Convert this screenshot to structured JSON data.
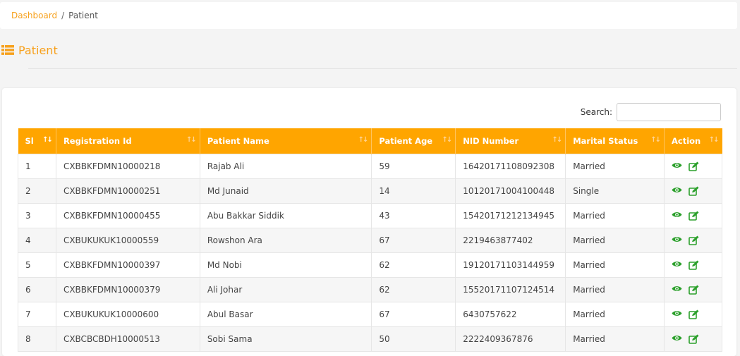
{
  "breadcrumb": {
    "home": "Dashboard",
    "separator": "/",
    "current": "Patient"
  },
  "page": {
    "title": "Patient"
  },
  "search": {
    "label": "Search:",
    "value": "",
    "placeholder": ""
  },
  "table": {
    "columns": [
      "Sl",
      "Registration Id",
      "Patient Name",
      "Patient Age",
      "NID Number",
      "Marital Status",
      "Action"
    ],
    "rows": [
      {
        "sl": "1",
        "reg": "CXBBKFDMN10000218",
        "name": "Rajab Ali",
        "age": "59",
        "nid": "16420171108092308",
        "marital": "Married"
      },
      {
        "sl": "2",
        "reg": "CXBBKFDMN10000251",
        "name": "Md Junaid",
        "age": "14",
        "nid": "10120171004100448",
        "marital": "Single"
      },
      {
        "sl": "3",
        "reg": "CXBBKFDMN10000455",
        "name": "Abu Bakkar Siddik",
        "age": "43",
        "nid": "15420171212134945",
        "marital": "Married"
      },
      {
        "sl": "4",
        "reg": "CXBUKUKUK10000559",
        "name": "Rowshon Ara",
        "age": "67",
        "nid": "2219463877402",
        "marital": "Married"
      },
      {
        "sl": "5",
        "reg": "CXBBKFDMN10000397",
        "name": "Md Nobi",
        "age": "62",
        "nid": "19120171103144959",
        "marital": "Married"
      },
      {
        "sl": "6",
        "reg": "CXBBKFDMN10000379",
        "name": "Ali Johar",
        "age": "62",
        "nid": "15520171107124514",
        "marital": "Married"
      },
      {
        "sl": "7",
        "reg": "CXBUKUKUK10000600",
        "name": "Abul Basar",
        "age": "67",
        "nid": "6430757622",
        "marital": "Married"
      },
      {
        "sl": "8",
        "reg": "CXBCBCBDH10000513",
        "name": "Sobi Sama",
        "age": "50",
        "nid": "2222409367876",
        "marital": "Married"
      }
    ]
  },
  "icons": {
    "title": "list-icon",
    "view": "eye-icon",
    "edit": "edit-icon",
    "sort": "sort-icon"
  },
  "colors": {
    "accent": "#ffa500",
    "brand_text": "#f7a11d",
    "action_green": "#2ca02c"
  }
}
